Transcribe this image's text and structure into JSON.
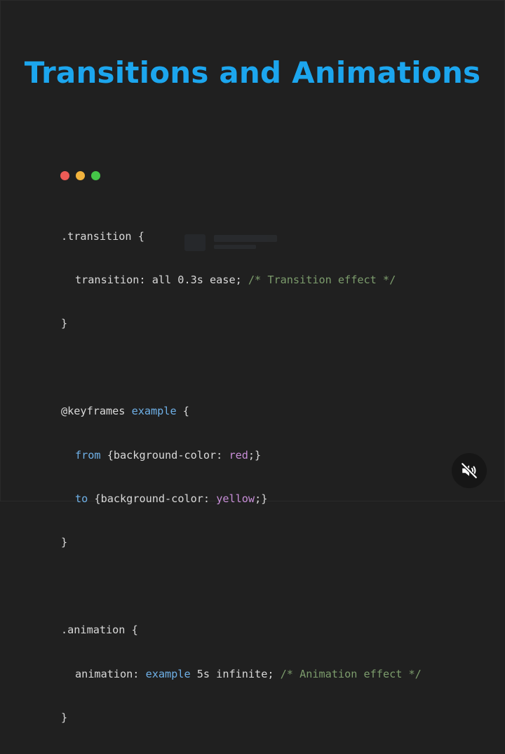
{
  "title": "Transitions and Animations",
  "window_dots": {
    "colors": [
      "#ec5b56",
      "#f2b33d",
      "#45c548"
    ]
  },
  "code": {
    "transition_selector": ".transition {",
    "transition_prop": "transition: all 0.3s ease;",
    "transition_comment": "/* Transition effect */",
    "transition_close": "}",
    "keyframes_at": "@keyframes",
    "keyframes_name": "example",
    "keyframes_open": "{",
    "from_kw": "from",
    "from_decl_a": "{background-color: ",
    "from_value": "red",
    "from_decl_b": ";}",
    "to_kw": "to",
    "to_decl_a": "{background-color: ",
    "to_value": "yellow",
    "to_decl_b": ";}",
    "keyframes_close": "}",
    "animation_selector": ".animation {",
    "animation_prop_a": "animation: ",
    "animation_name": "example",
    "animation_prop_b": " 5s infinite;",
    "animation_comment": "/* Animation effect */",
    "animation_close": "}"
  },
  "controls": {
    "mute_icon": "speaker-muted-icon"
  },
  "colors": {
    "background": "#202020",
    "title": "#1ca6ee",
    "code_text": "#d9d9d9",
    "comment": "#7c9c6c",
    "keyword": "#6fb1e8",
    "value": "#c88ed8"
  }
}
